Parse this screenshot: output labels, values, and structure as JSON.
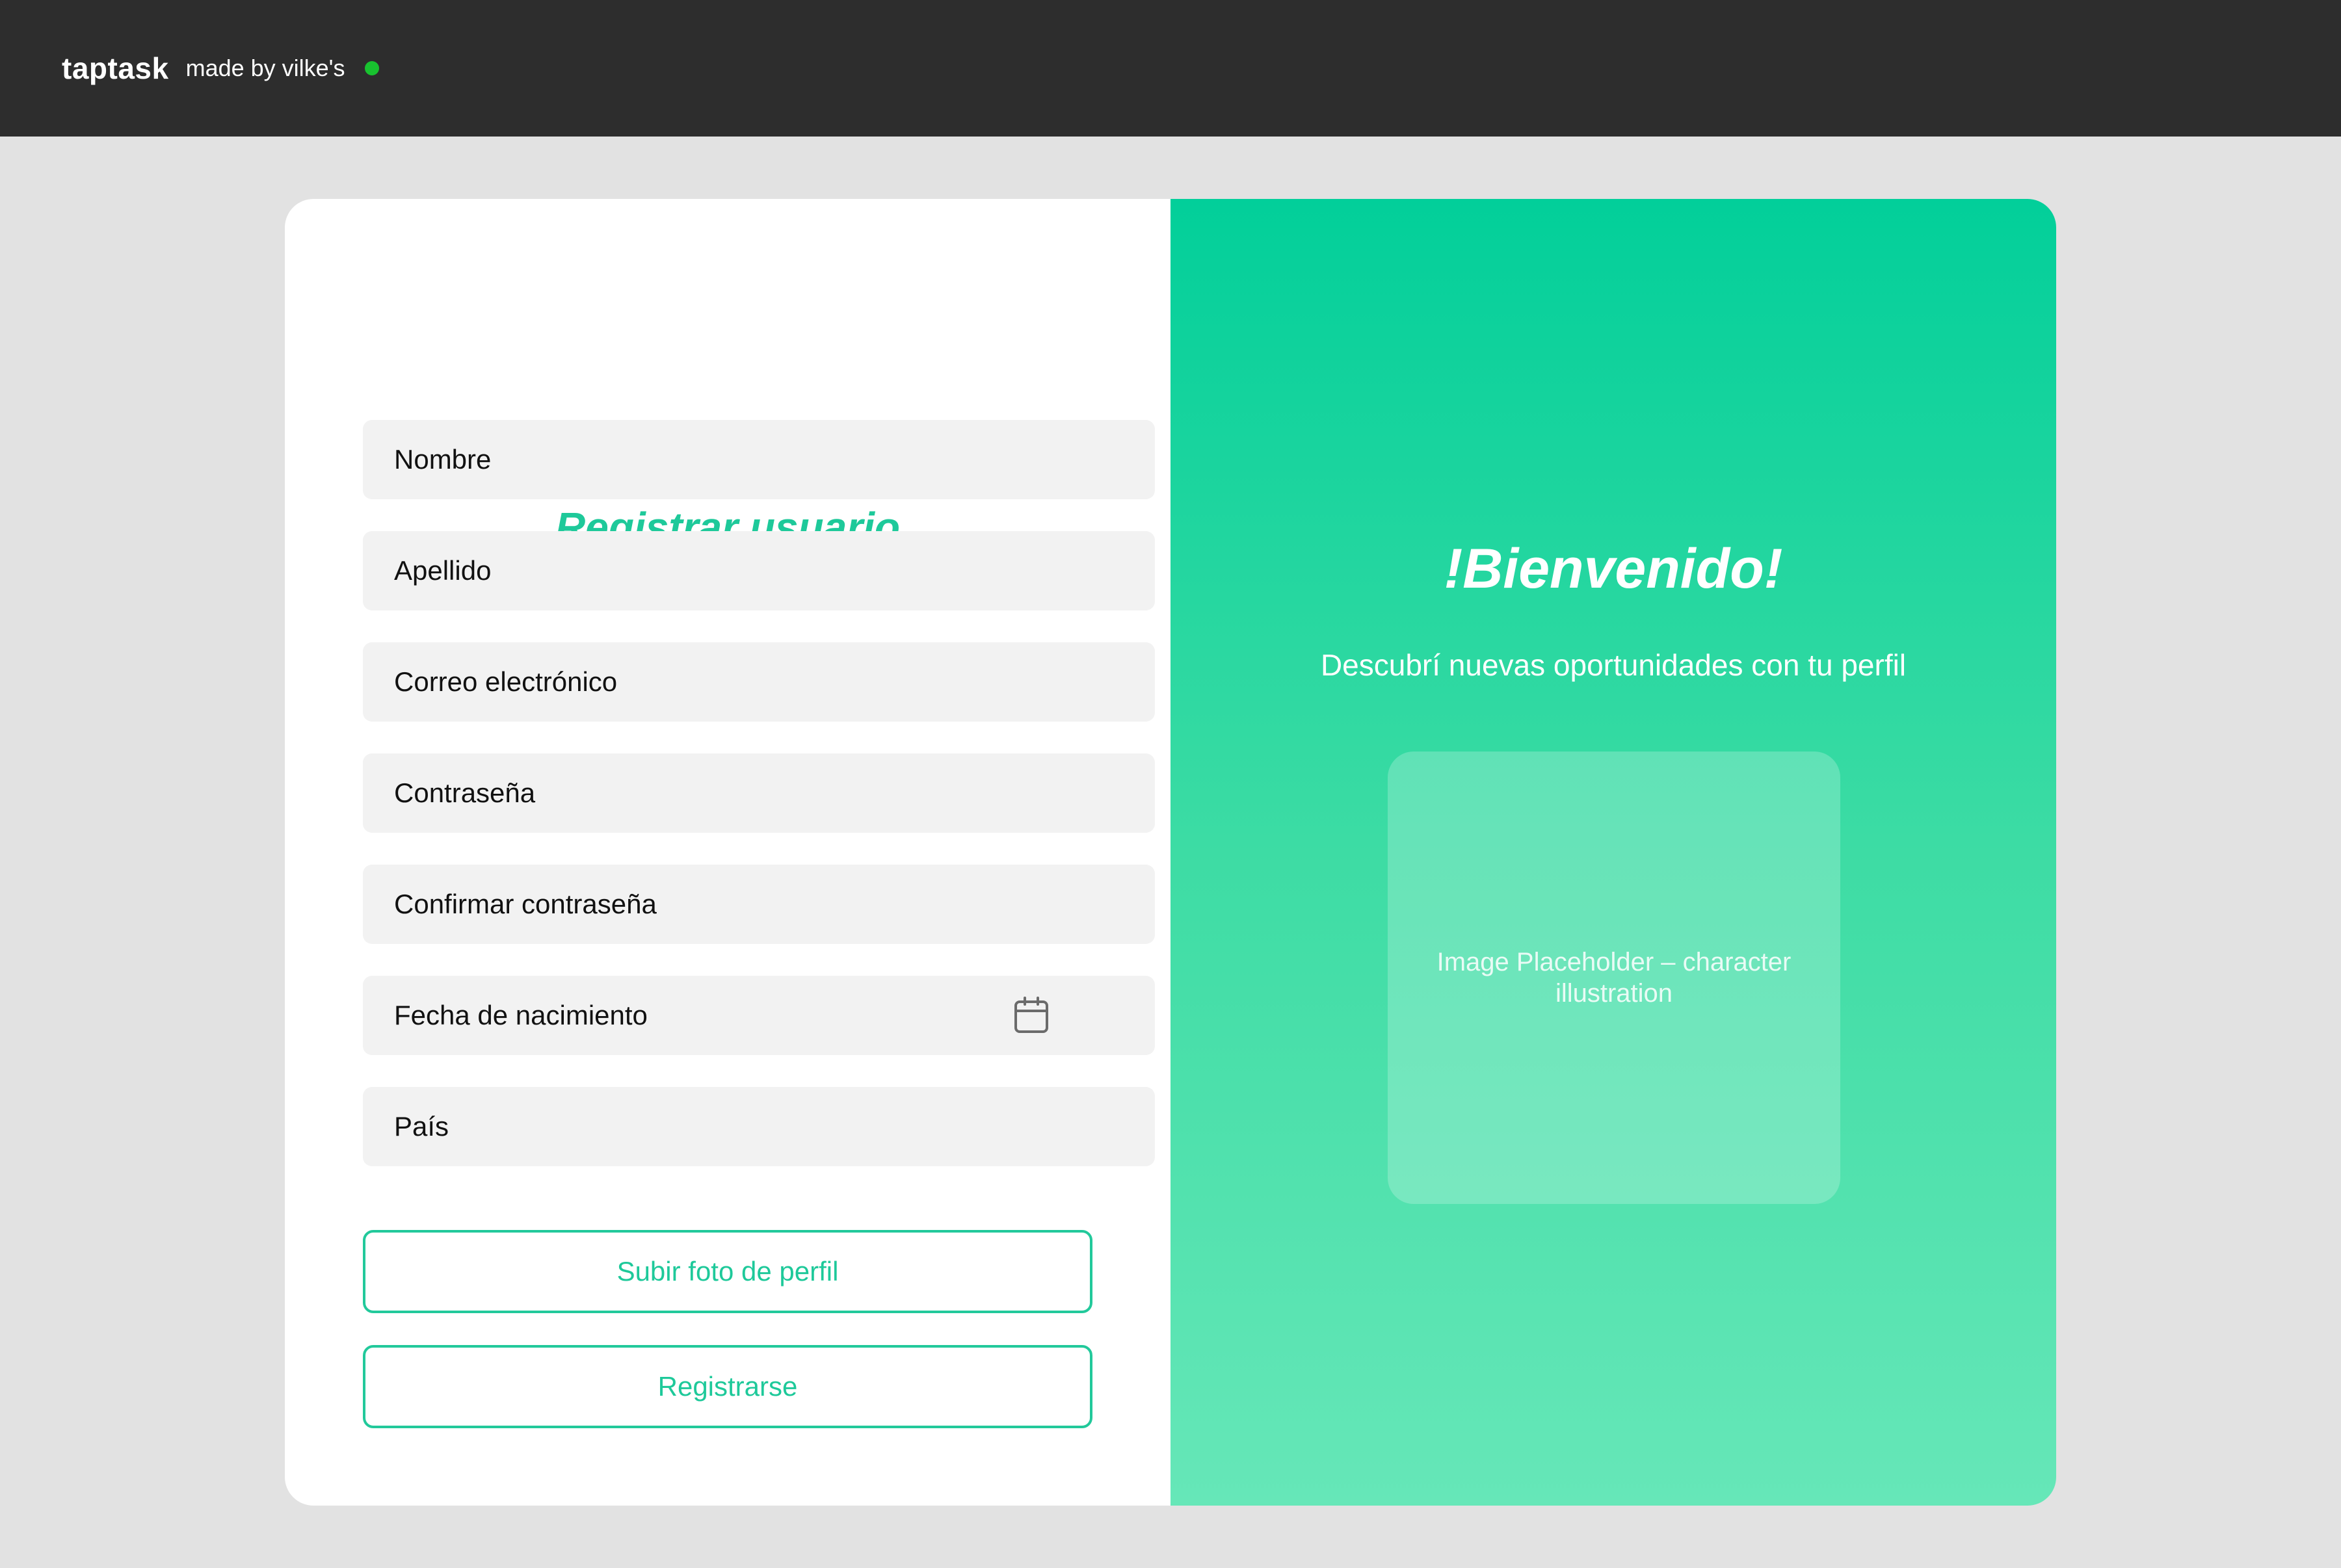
{
  "topbar": {
    "brand": "taptask",
    "made_by": "made by vilke's",
    "status_color": "#18c22f"
  },
  "form": {
    "title": "Registrar usuario",
    "fields": [
      {
        "label": "Nombre"
      },
      {
        "label": "Apellido"
      },
      {
        "label": "Correo electrónico"
      },
      {
        "label": "Contraseña"
      },
      {
        "label": "Confirmar contraseña"
      },
      {
        "label": "Fecha de nacimiento",
        "icon": "calendar-icon"
      },
      {
        "label": "País"
      }
    ],
    "upload_button": "Subir foto de perfil",
    "register_button": "Registrarse"
  },
  "welcome_panel": {
    "heading": "!Bienvenido!",
    "subtitle": "Descubrí nuevas oportunidades con tu perfil",
    "image_placeholder": "Image Placeholder – character illustration"
  },
  "colors": {
    "accent": "#1ec99a",
    "topbar_bg": "#2d2d2d",
    "page_bg": "#e2e2e2",
    "field_bg": "#f2f2f2",
    "gradient_top": "#02cf9a",
    "gradient_bottom": "#66e7b8"
  }
}
